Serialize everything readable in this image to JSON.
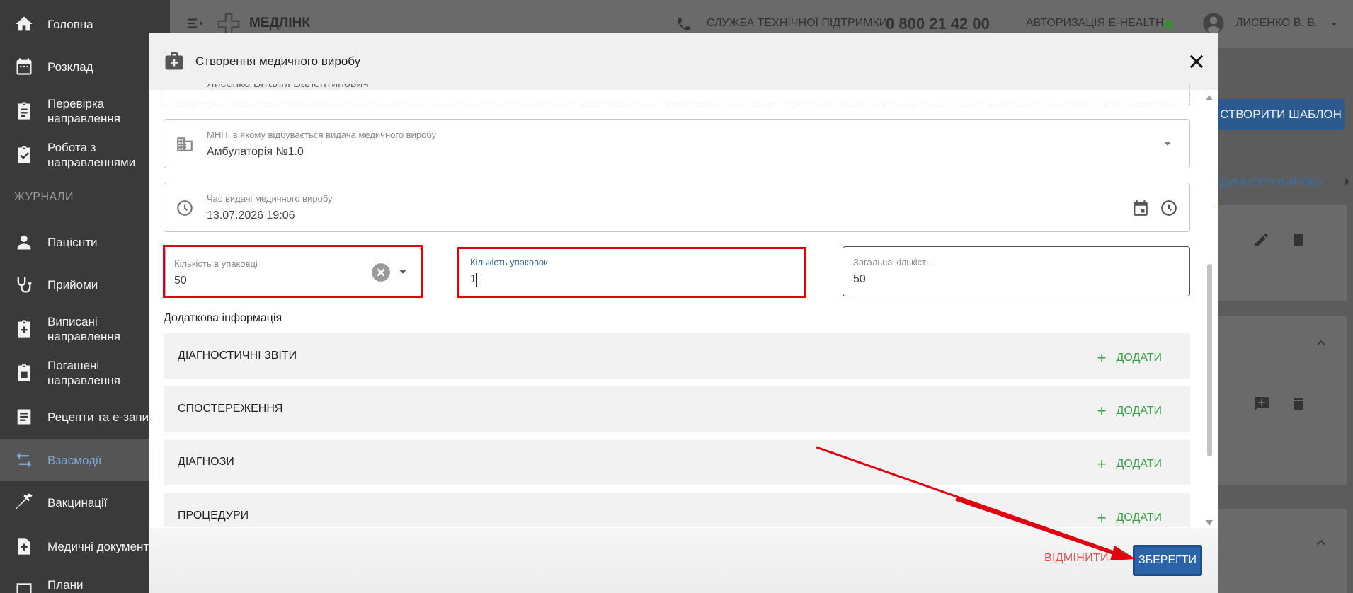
{
  "sidebar": {
    "section_label": "ЖУРНАЛИ",
    "items": [
      {
        "label": "Головна",
        "icon": "home-icon"
      },
      {
        "label": "Розклад",
        "icon": "calendar-icon"
      },
      {
        "label": "Перевірка направлення",
        "icon": "clipboard-check-icon"
      },
      {
        "label": "Робота з направленнями",
        "icon": "clipboard-icon"
      },
      {
        "label": "Пацієнти",
        "icon": "person-icon"
      },
      {
        "label": "Прийоми",
        "icon": "stethoscope-icon"
      },
      {
        "label": "Виписані направлення",
        "icon": "clipboard-plus-icon"
      },
      {
        "label": "Погашені направлення",
        "icon": "clipboard-done-icon"
      },
      {
        "label": "Рецепти та е-запити",
        "icon": "list-icon"
      },
      {
        "label": "Взаємодії",
        "icon": "swap-icon"
      },
      {
        "label": "Вакцинації",
        "icon": "syringe-icon"
      },
      {
        "label": "Медичні документи",
        "icon": "document-plus-icon"
      },
      {
        "label": "Плани",
        "icon": "plan-icon"
      }
    ],
    "active": "Взаємодії"
  },
  "topbar": {
    "logo_text": "МЕДЛІНК",
    "support_label": "СЛУЖБА ТЕХНІЧНОЇ ПІДТРИМКИ",
    "support_phone": "0 800 21 42 00",
    "auth_label": "АВТОРИЗАЦІЯ E-HEALTH",
    "user_name": "ЛИСЕНКО В. В."
  },
  "background": {
    "create_template_button": "СТВОРИТИ ШАБЛОН",
    "tab_label": "ЕДИЧНОГО ВИРОБУ"
  },
  "modal": {
    "title": "Створення медичного виробу",
    "top_field_value": "Лисенко Віталій Валентинович",
    "mnp_field": {
      "label": "МНП, в якому відбувається видача медичного виробу",
      "value": "Амбулаторія №1.0"
    },
    "time_field": {
      "label": "Час видачі медичного виробу",
      "value": "13.07.2026 19:06"
    },
    "qty_in_pack": {
      "label": "Кількість в упаковці",
      "value": "50"
    },
    "pack_count": {
      "label": "Кількість упаковок",
      "value": "1"
    },
    "total_qty": {
      "label": "Загальна кількість",
      "value": "50"
    },
    "additional_info_label": "Додаткова інформація",
    "sections": [
      {
        "title": "ДІАГНОСТИЧНІ ЗВІТИ",
        "add": "ДОДАТИ"
      },
      {
        "title": "СПОСТЕРЕЖЕННЯ",
        "add": "ДОДАТИ"
      },
      {
        "title": "ДІАГНОЗИ",
        "add": "ДОДАТИ"
      },
      {
        "title": "ПРОЦЕДУРИ",
        "add": "ДОДАТИ"
      }
    ],
    "cancel_label": "ВІДМІНИТИ",
    "save_label": "ЗБЕРЕГТИ"
  },
  "colors": {
    "accent_blue": "#2b63a8",
    "highlight_red": "#e00012",
    "add_green": "#3aa04a",
    "active_nav": "#7ea6d3"
  }
}
